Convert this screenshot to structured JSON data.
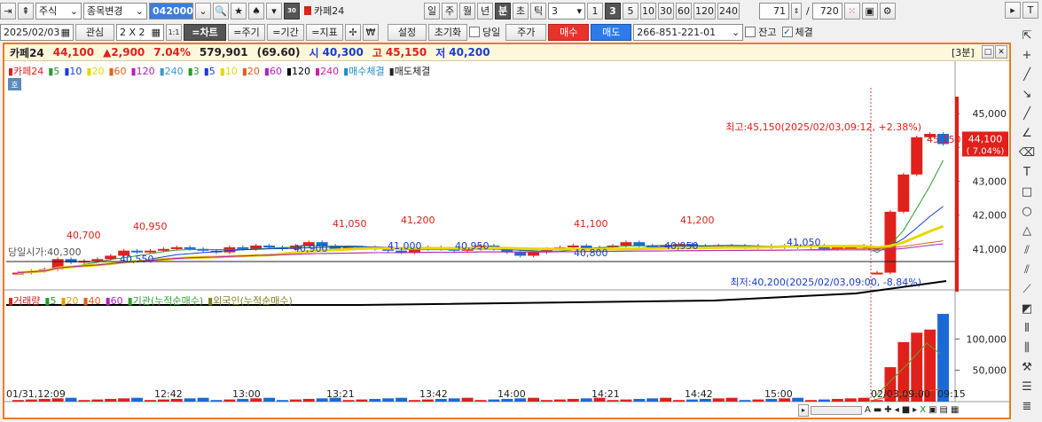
{
  "toolbar1": {
    "market": "주식",
    "change_label": "종목변경",
    "code": "042000",
    "name": "카페24",
    "periods": [
      "일",
      "주",
      "월",
      "년",
      "분",
      "초",
      "틱"
    ],
    "active_period": "분",
    "interval_value": "3",
    "quick_intervals": [
      "1",
      "3",
      "5",
      "10",
      "30",
      "60",
      "120",
      "240"
    ],
    "active_quick": "3",
    "count_value": "71",
    "count_total": "720"
  },
  "toolbar2": {
    "date": "2025/02/03",
    "watch_label": "관심",
    "grid_label": "2 X 2",
    "chart_btn": "=차트",
    "period_btn": "=주기",
    "range_btn": "=기간",
    "indicator_btn": "=지표",
    "currency_label": "₩",
    "settings_label": "설정",
    "reset_label": "초기화",
    "today_label": "당일",
    "price_label": "주가",
    "buy_label": "매수",
    "sell_label": "매도",
    "account": "266-851-221-01",
    "balance_label": "잔고",
    "filled_label": "체결"
  },
  "info": {
    "name": "카페24",
    "price": "44,100",
    "change": "▲2,900",
    "pct": "7.04%",
    "volume": "579,901",
    "vol_ratio": "(69.60)",
    "open_label": "시",
    "open": "40,300",
    "high_label": "고",
    "high": "45,150",
    "low_label": "저",
    "low": "40,200",
    "timeframe": "[3분]"
  },
  "price_legend": [
    "카페24",
    "5",
    "10",
    "20",
    "60",
    "120",
    "240",
    "3",
    "5",
    "10",
    "20",
    "60",
    "120",
    "240",
    "매수체결",
    "매도체결"
  ],
  "price_legend_colors": [
    "#e0201a",
    "#2a9a2a",
    "#1a3bd6",
    "#e6d800",
    "#e0601a",
    "#b020c0",
    "#3a9ad0",
    "#2a9a2a",
    "#1a3bd6",
    "#e6d800",
    "#e0601a",
    "#b020c0",
    "#000000",
    "#d020a0",
    "#1a8ad0"
  ],
  "volume_legend": [
    "거래량",
    "5",
    "20",
    "40",
    "60",
    "기관(누적순매수)",
    "외국인(누적순매수)"
  ],
  "volume_legend_colors": [
    "#e0201a",
    "#2a9a2a",
    "#e6a000",
    "#e0601a",
    "#b020c0",
    "#3aa03a",
    "#808020"
  ],
  "annotations": {
    "high_note": "최고:45,150(2025/02/03,09:12, +2.38%)",
    "low_note": "최저:40,200(2025/02/03,09:00, -8.84%)",
    "prev_close_note": "당일시가:40,300",
    "peaks": [
      "40,700",
      "40,950",
      "41,050",
      "41,200",
      "41,100",
      "41,200",
      "45,150"
    ],
    "troughs": [
      "40,550",
      "40,900",
      "41,000",
      "40,950",
      "40,800",
      "40,950",
      "41,050"
    ]
  },
  "price_axis": [
    "45,000",
    "44,000",
    "43,000",
    "42,000",
    "41,000"
  ],
  "current_price_tag": [
    "44,100",
    "( 7.04%)"
  ],
  "volume_axis": [
    "100,000",
    "50,000"
  ],
  "x_axis": [
    "01/31,12:09",
    "12:42",
    "13:00",
    "13:21",
    "13:42",
    "14:00",
    "14:21",
    "14:42",
    "15:00",
    "02/03,09:00",
    "09:15"
  ],
  "chart_data": {
    "type": "candlestick",
    "symbol": "카페24",
    "interval": "3분",
    "ylim": [
      40000,
      45500
    ],
    "candles_close": [
      40300,
      40350,
      40400,
      40700,
      40600,
      40650,
      40700,
      40800,
      40950,
      40900,
      40950,
      41000,
      41050,
      41000,
      40950,
      40900,
      41050,
      41000,
      41100,
      41050,
      41000,
      41100,
      41200,
      41100,
      41000,
      41050,
      41050,
      41000,
      40950,
      40900,
      41000,
      41050,
      41000,
      40950,
      41000,
      41100,
      41000,
      40900,
      40800,
      40900,
      41000,
      41050,
      41100,
      41000,
      41050,
      41100,
      41200,
      41100,
      41050,
      41100,
      41150,
      41100,
      41050,
      41100,
      41100,
      41050,
      41100,
      41050,
      41100,
      41050,
      41100,
      41000,
      41050,
      41050,
      41100,
      40300,
      42100,
      43200,
      44300,
      44400,
      44100
    ],
    "volume_ylim": [
      0,
      150000
    ],
    "volume_tail": [
      55000,
      95000,
      110000,
      115000,
      140000
    ]
  }
}
